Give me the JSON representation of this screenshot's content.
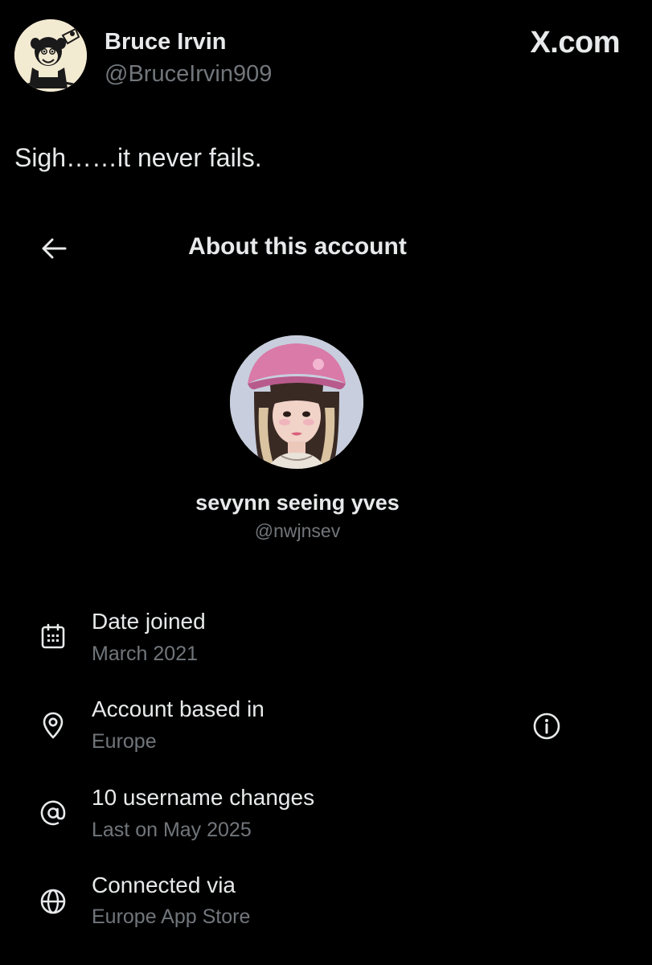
{
  "tweet": {
    "author_name": "Bruce Irvin",
    "author_handle": "@BruceIrvin909",
    "site": "X.com",
    "text": "Sigh……it never fails."
  },
  "about_panel": {
    "title": "About this account",
    "profile": {
      "name": "sevynn seeing yves",
      "handle": "@nwjnsev"
    },
    "rows": [
      {
        "icon": "calendar-icon",
        "label": "Date joined",
        "value": "March 2021"
      },
      {
        "icon": "location-pin-icon",
        "label": "Account based in",
        "value": "Europe"
      },
      {
        "icon": "at-sign-icon",
        "label": "10 username changes",
        "value": "Last on May 2025"
      },
      {
        "icon": "globe-icon",
        "label": "Connected via",
        "value": "Europe App Store"
      }
    ]
  },
  "colors": {
    "background": "#000000",
    "primary_text": "#e7e9ea",
    "secondary_text": "#71767b"
  }
}
